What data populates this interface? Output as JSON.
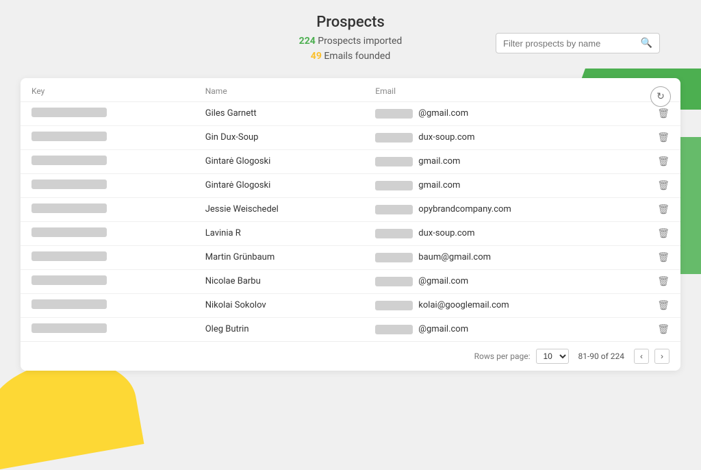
{
  "header": {
    "title": "Prospects",
    "stats": {
      "count_green": "224",
      "label_green": "Prospects imported",
      "count_yellow": "49",
      "label_yellow": "Emails founded"
    }
  },
  "search": {
    "placeholder": "Filter prospects by name"
  },
  "table": {
    "columns": [
      "Key",
      "Name",
      "Email"
    ],
    "rows": [
      {
        "name": "Giles Garnett",
        "email_suffix": "@gmail.com"
      },
      {
        "name": "Gin Dux-Soup",
        "email_suffix": "dux-soup.com"
      },
      {
        "name": "Gintarė Glogoski",
        "email_suffix": "gmail.com"
      },
      {
        "name": "Gintarė Glogoski",
        "email_suffix": "gmail.com"
      },
      {
        "name": "Jessie Weischedel",
        "email_suffix": "opybrandcompany.com"
      },
      {
        "name": "Lavinia R",
        "email_suffix": "dux-soup.com"
      },
      {
        "name": "Martin Grünbaum",
        "email_suffix": "baum@gmail.com"
      },
      {
        "name": "Nicolae Barbu",
        "email_suffix": "@gmail.com"
      },
      {
        "name": "Nikolai Sokolov",
        "email_suffix": "kolai@googlemail.com"
      },
      {
        "name": "Oleg Butrin",
        "email_suffix": "@gmail.com"
      }
    ]
  },
  "pagination": {
    "rows_per_page_label": "Rows per page:",
    "rows_per_page_value": "10",
    "page_info": "81-90 of 224",
    "prev_label": "‹",
    "next_label": "›"
  },
  "icons": {
    "search": "🔍",
    "delete": "🗑",
    "refresh": "↻"
  }
}
